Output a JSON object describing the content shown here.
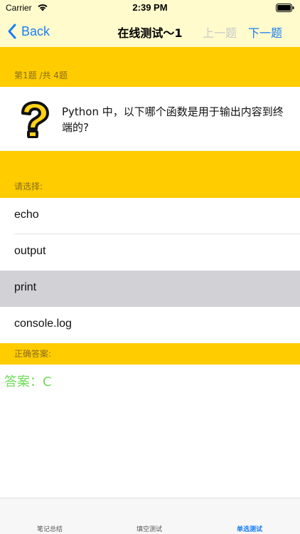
{
  "status": {
    "carrier": "Carrier",
    "time": "2:39 PM"
  },
  "nav": {
    "back_label": "Back",
    "title": "在线测试～1",
    "prev_label": "上一题",
    "next_label": "下一题"
  },
  "progress": "第1题 /共 4题",
  "question": "Python 中，以下哪个函数是用于输出内容到终端的?",
  "choose_label": "请选择:",
  "options": [
    {
      "label": "echo"
    },
    {
      "label": "output"
    },
    {
      "label": "print"
    },
    {
      "label": "console.log"
    }
  ],
  "selected_option": 2,
  "correct_label": "正确答案:",
  "answer": "答案：C",
  "tabs": [
    {
      "label": "笔记总结"
    },
    {
      "label": "填空测试"
    },
    {
      "label": "单选测试"
    }
  ],
  "colors": {
    "accent": "#1a7ef5",
    "header": "#ffcc00",
    "nav_bg": "#fffbcc",
    "answer": "#6fdc5a",
    "selected": "#d1d1d6"
  }
}
